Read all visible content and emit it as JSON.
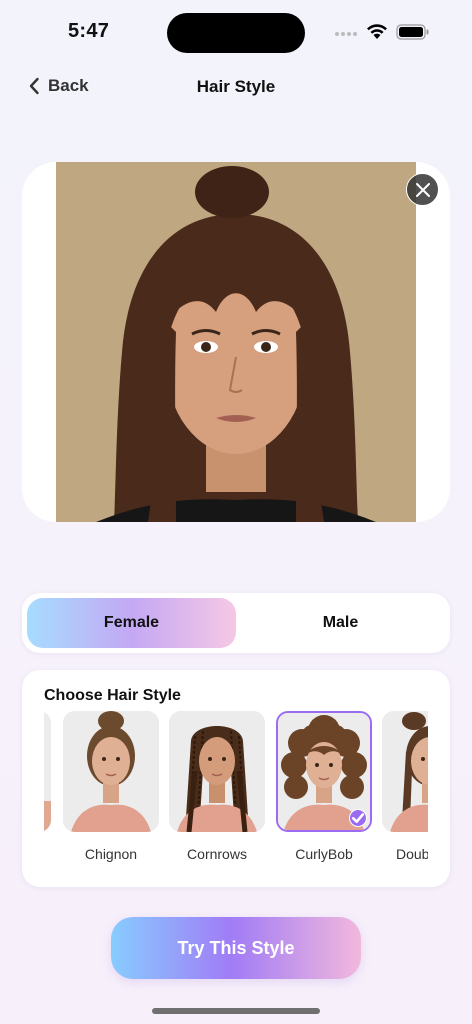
{
  "status_bar": {
    "time": "5:47",
    "icons": [
      "signal-icon",
      "wifi-icon",
      "battery-icon"
    ]
  },
  "nav": {
    "back_label": "Back",
    "title": "Hair Style",
    "back_icon": "chevron-left-icon"
  },
  "photo": {
    "close_icon": "close-icon"
  },
  "gender": {
    "options": [
      "Female",
      "Male"
    ],
    "selected": "Female"
  },
  "hair_styles": {
    "title": "Choose Hair Style",
    "items": [
      {
        "label": ""
      },
      {
        "label": "Chignon"
      },
      {
        "label": "Cornrows"
      },
      {
        "label": "CurlyBob",
        "selected": true
      },
      {
        "label": "Doub"
      }
    ]
  },
  "cta": {
    "label": "Try This Style"
  },
  "colors": {
    "accent": "#9b6cf2",
    "gradient_start": "#88ccff",
    "gradient_end": "#f2b8dc"
  }
}
